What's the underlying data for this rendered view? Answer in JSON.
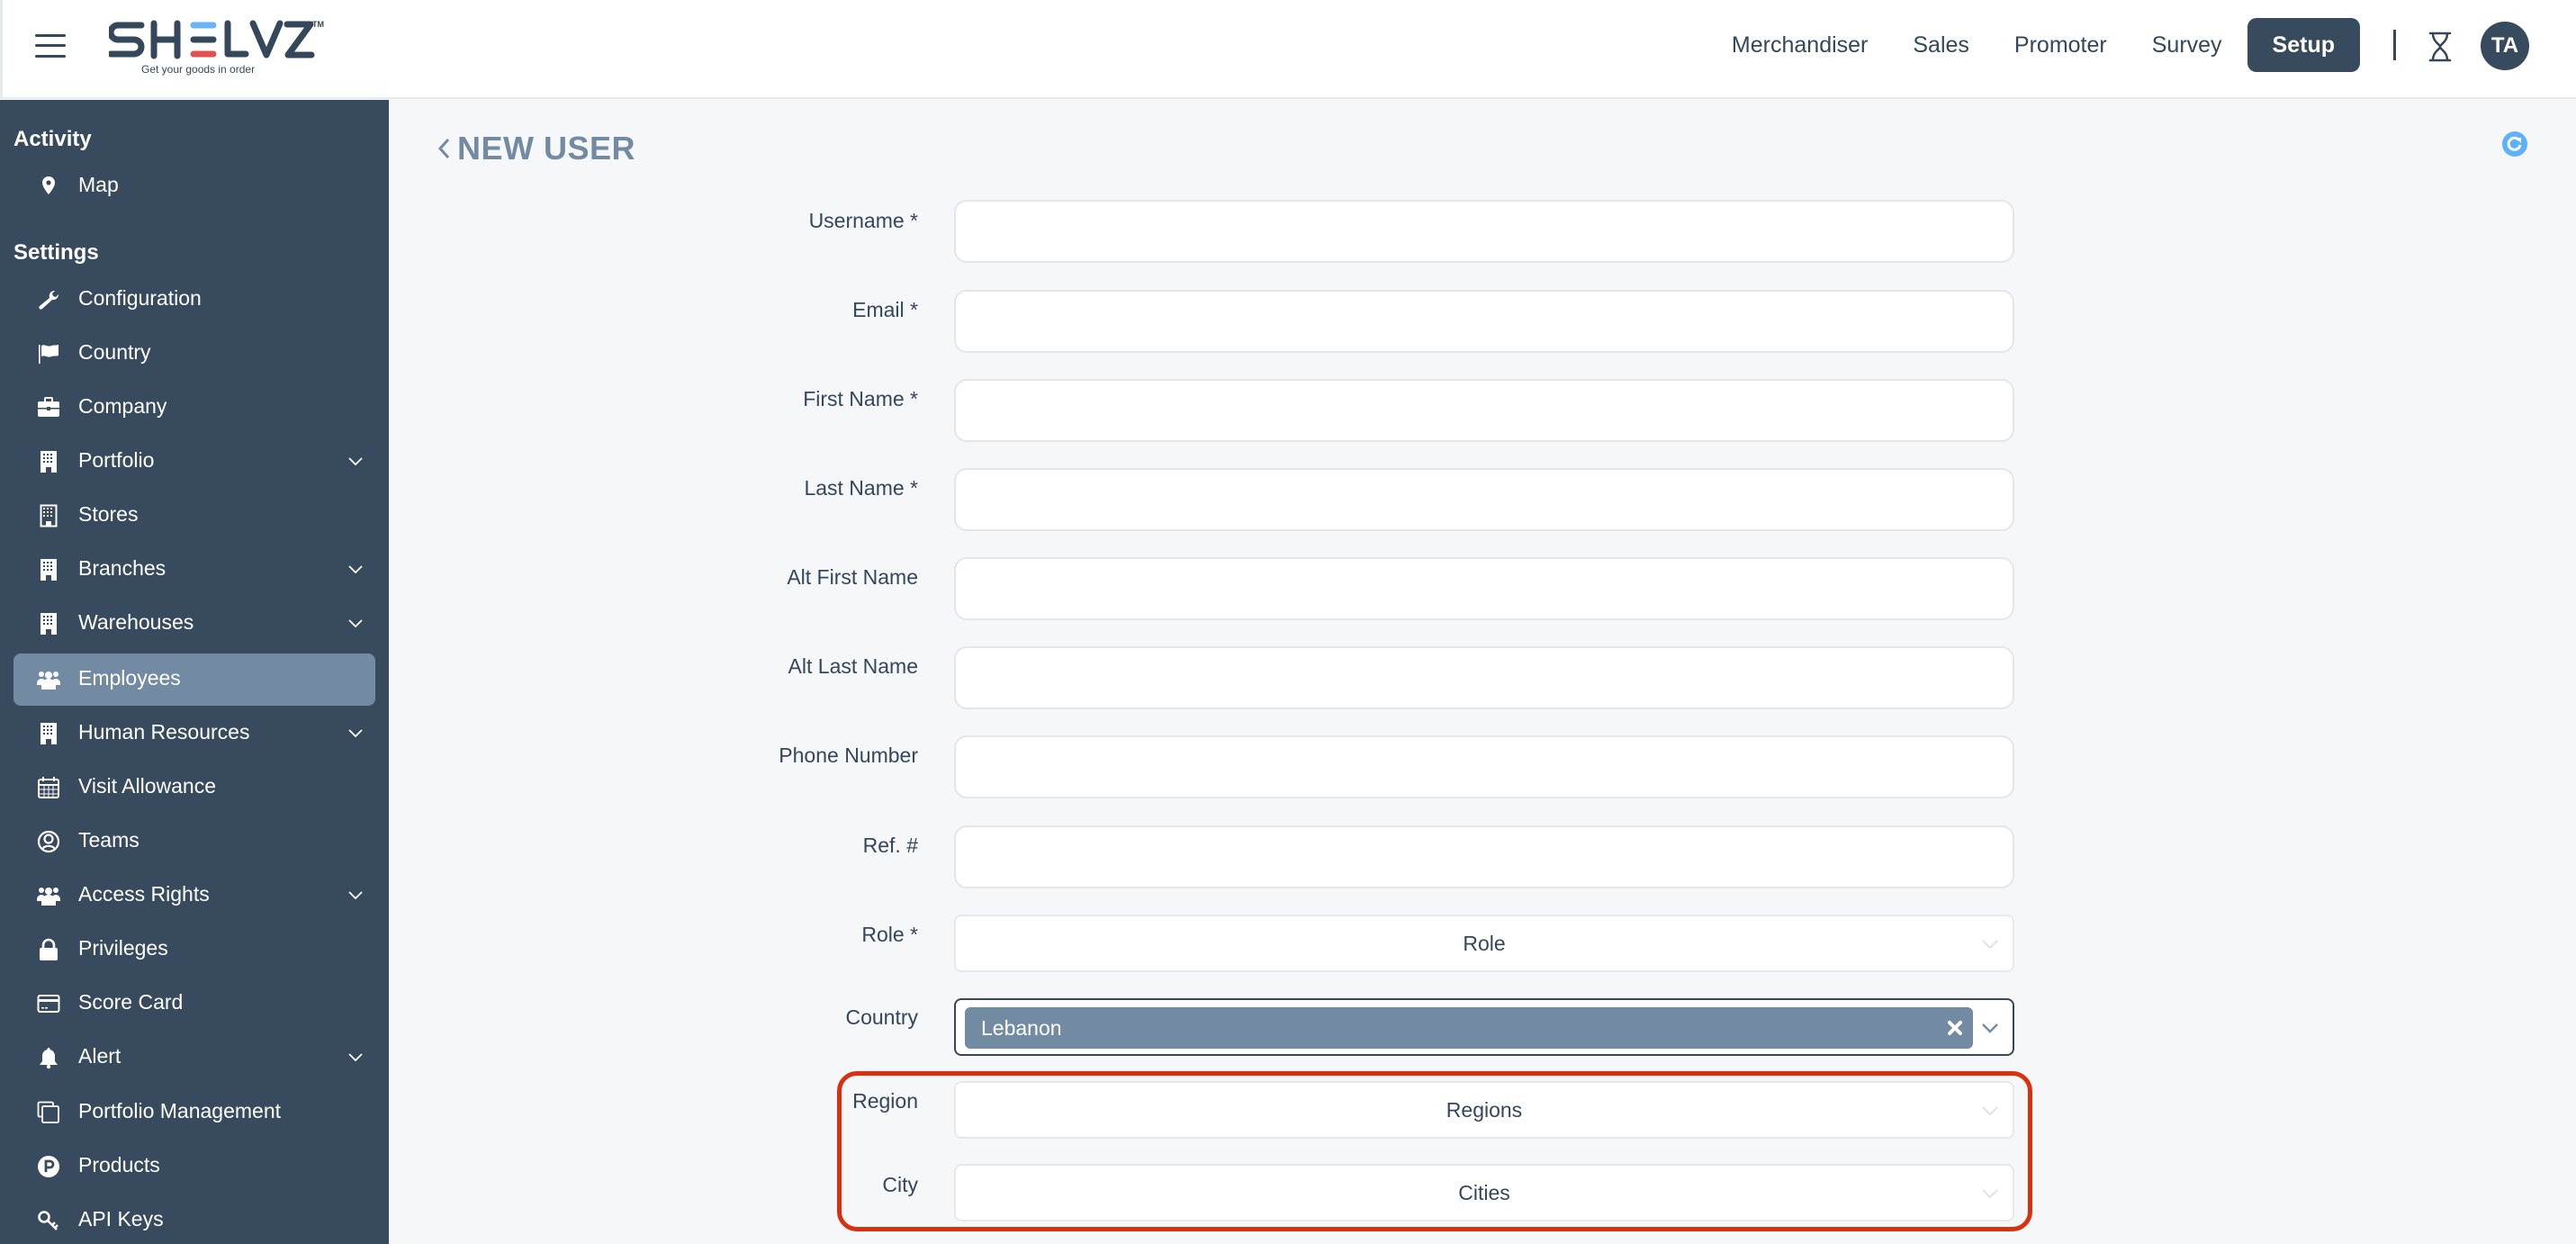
{
  "header": {
    "logo": {
      "word_pre": "SH",
      "word_e": "E",
      "word_post": "LVZ",
      "tm": "TM",
      "tagline": "Get your goods in order",
      "accent_blue": "#6ab4f5",
      "accent_red": "#e05252"
    },
    "nav": [
      {
        "label": "Merchandiser",
        "active": false
      },
      {
        "label": "Sales",
        "active": false
      },
      {
        "label": "Promoter",
        "active": false
      },
      {
        "label": "Survey",
        "active": false
      },
      {
        "label": "Setup",
        "active": true
      }
    ],
    "hourglass_icon": "hourglass-icon",
    "avatar_initials": "TA"
  },
  "sidebar": {
    "sections": [
      {
        "title": "Activity",
        "items": [
          {
            "label": "Map",
            "icon": "map-pin-icon",
            "expandable": false
          }
        ]
      },
      {
        "title": "Settings",
        "items": [
          {
            "label": "Configuration",
            "icon": "wrench-icon",
            "expandable": false
          },
          {
            "label": "Country",
            "icon": "flag-icon",
            "expandable": false
          },
          {
            "label": "Company",
            "icon": "briefcase-icon",
            "expandable": false
          },
          {
            "label": "Portfolio",
            "icon": "building-icon",
            "expandable": true
          },
          {
            "label": "Stores",
            "icon": "building-icon",
            "expandable": false
          },
          {
            "label": "Branches",
            "icon": "building-icon",
            "expandable": true
          },
          {
            "label": "Warehouses",
            "icon": "building-icon",
            "expandable": true
          },
          {
            "label": "Employees",
            "icon": "users-icon",
            "expandable": false,
            "active": true
          },
          {
            "label": "Human Resources",
            "icon": "building-icon",
            "expandable": true
          },
          {
            "label": "Visit Allowance",
            "icon": "calendar-icon",
            "expandable": false
          },
          {
            "label": "Teams",
            "icon": "user-circle-icon",
            "expandable": false
          },
          {
            "label": "Access Rights",
            "icon": "users-icon",
            "expandable": true
          },
          {
            "label": "Privileges",
            "icon": "lock-icon",
            "expandable": false
          },
          {
            "label": "Score Card",
            "icon": "credit-card-icon",
            "expandable": false
          },
          {
            "label": "Alert",
            "icon": "bell-icon",
            "expandable": true
          },
          {
            "label": "Portfolio Management",
            "icon": "copy-icon",
            "expandable": false
          },
          {
            "label": "Products",
            "icon": "product-p-icon",
            "expandable": false
          },
          {
            "label": "API Keys",
            "icon": "key-icon",
            "expandable": false
          }
        ]
      }
    ]
  },
  "main": {
    "title": "NEW USER",
    "refresh_color": "#5fb0ff",
    "fields": {
      "username": {
        "label": "Username *",
        "value": "",
        "placeholder": ""
      },
      "email": {
        "label": "Email *",
        "value": "",
        "placeholder": ""
      },
      "first_name": {
        "label": "First Name *",
        "value": "",
        "placeholder": ""
      },
      "last_name": {
        "label": "Last Name *",
        "value": "",
        "placeholder": ""
      },
      "alt_first_name": {
        "label": "Alt First Name",
        "value": "",
        "placeholder": ""
      },
      "alt_last_name": {
        "label": "Alt Last Name",
        "value": "",
        "placeholder": ""
      },
      "phone": {
        "label": "Phone Number",
        "value": "",
        "placeholder": ""
      },
      "ref": {
        "label": "Ref. #",
        "value": "",
        "placeholder": ""
      },
      "role": {
        "label": "Role *",
        "placeholder": "Role"
      },
      "country": {
        "label": "Country",
        "selected": [
          "Lebanon"
        ]
      },
      "region": {
        "label": "Region",
        "placeholder": "Regions"
      },
      "city": {
        "label": "City",
        "placeholder": "Cities"
      }
    },
    "highlight_color": "#d9300f"
  }
}
